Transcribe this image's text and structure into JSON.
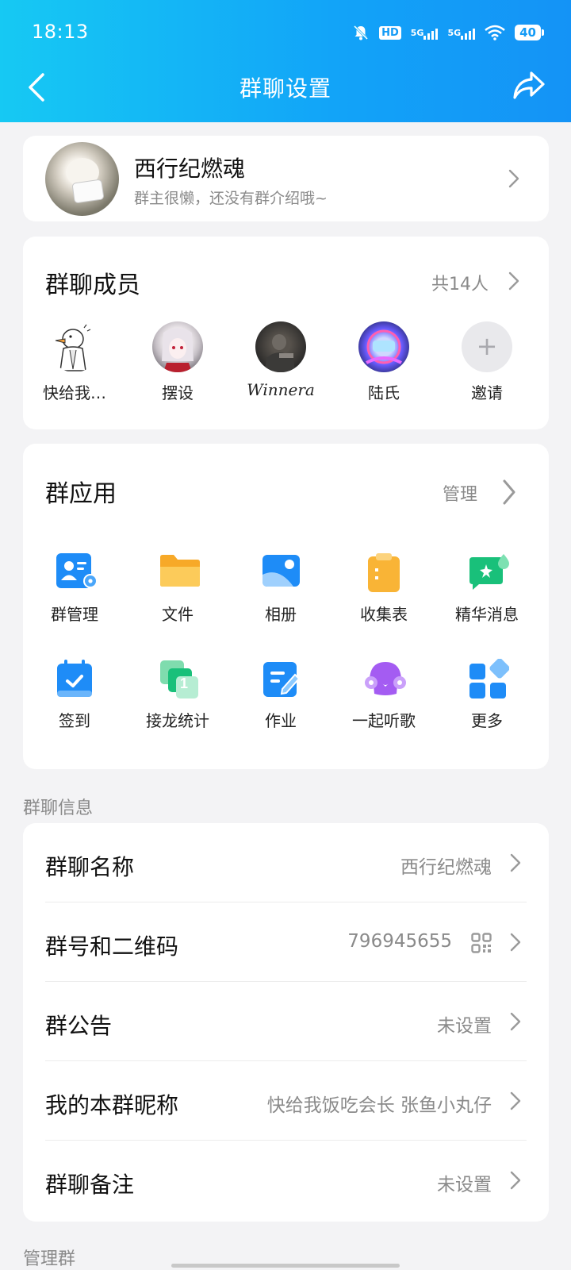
{
  "status_bar": {
    "time": "18:13",
    "hd_badge": "HD",
    "net1": "5G",
    "net2": "5G",
    "battery": "40",
    "icons": [
      "bell-muted-icon",
      "hd-icon",
      "signal-icon",
      "signal-icon",
      "wifi-icon",
      "battery-icon"
    ]
  },
  "nav": {
    "title": "群聊设置",
    "back_icon": "chevron-left-icon",
    "share_icon": "share-icon"
  },
  "group": {
    "name": "西行纪燃魂",
    "description": "群主很懒，还没有群介绍哦~"
  },
  "members": {
    "title": "群聊成员",
    "count_text": "共14人",
    "list": [
      {
        "name": "快给我…",
        "avatar": "duck"
      },
      {
        "name": "摆设",
        "avatar": "anime"
      },
      {
        "name": "Winnera",
        "avatar": "dark"
      },
      {
        "name": "陆氏",
        "avatar": "colorful"
      }
    ],
    "invite_label": "邀请"
  },
  "apps": {
    "title": "群应用",
    "manage_label": "管理",
    "items": [
      {
        "label": "群管理",
        "icon": "group-manage-icon",
        "color": "#1e8cf7"
      },
      {
        "label": "文件",
        "icon": "folder-icon",
        "color": "#f9b436"
      },
      {
        "label": "相册",
        "icon": "album-icon",
        "color": "#1e8cf7"
      },
      {
        "label": "收集表",
        "icon": "clipboard-icon",
        "color": "#f9b436"
      },
      {
        "label": "精华消息",
        "icon": "essence-message-icon",
        "color": "#19c07a"
      },
      {
        "label": "签到",
        "icon": "calendar-check-icon",
        "color": "#1e8cf7"
      },
      {
        "label": "接龙统计",
        "icon": "relay-count-icon",
        "color": "#19c07a"
      },
      {
        "label": "作业",
        "icon": "homework-icon",
        "color": "#1e8cf7"
      },
      {
        "label": "一起听歌",
        "icon": "listen-music-icon",
        "color": "#a45cf2"
      },
      {
        "label": "更多",
        "icon": "more-grid-icon",
        "color": "#1e8cf7"
      }
    ]
  },
  "info": {
    "section_label": "群聊信息",
    "rows": [
      {
        "label": "群聊名称",
        "value": "西行纪燃魂"
      },
      {
        "label": "群号和二维码",
        "value": "796945655"
      },
      {
        "label": "群公告",
        "value": "未设置"
      },
      {
        "label": "我的本群昵称",
        "value": "快给我饭吃会长 张鱼小丸仔"
      },
      {
        "label": "群聊备注",
        "value": "未设置"
      }
    ]
  },
  "manage_section_label": "管理群"
}
